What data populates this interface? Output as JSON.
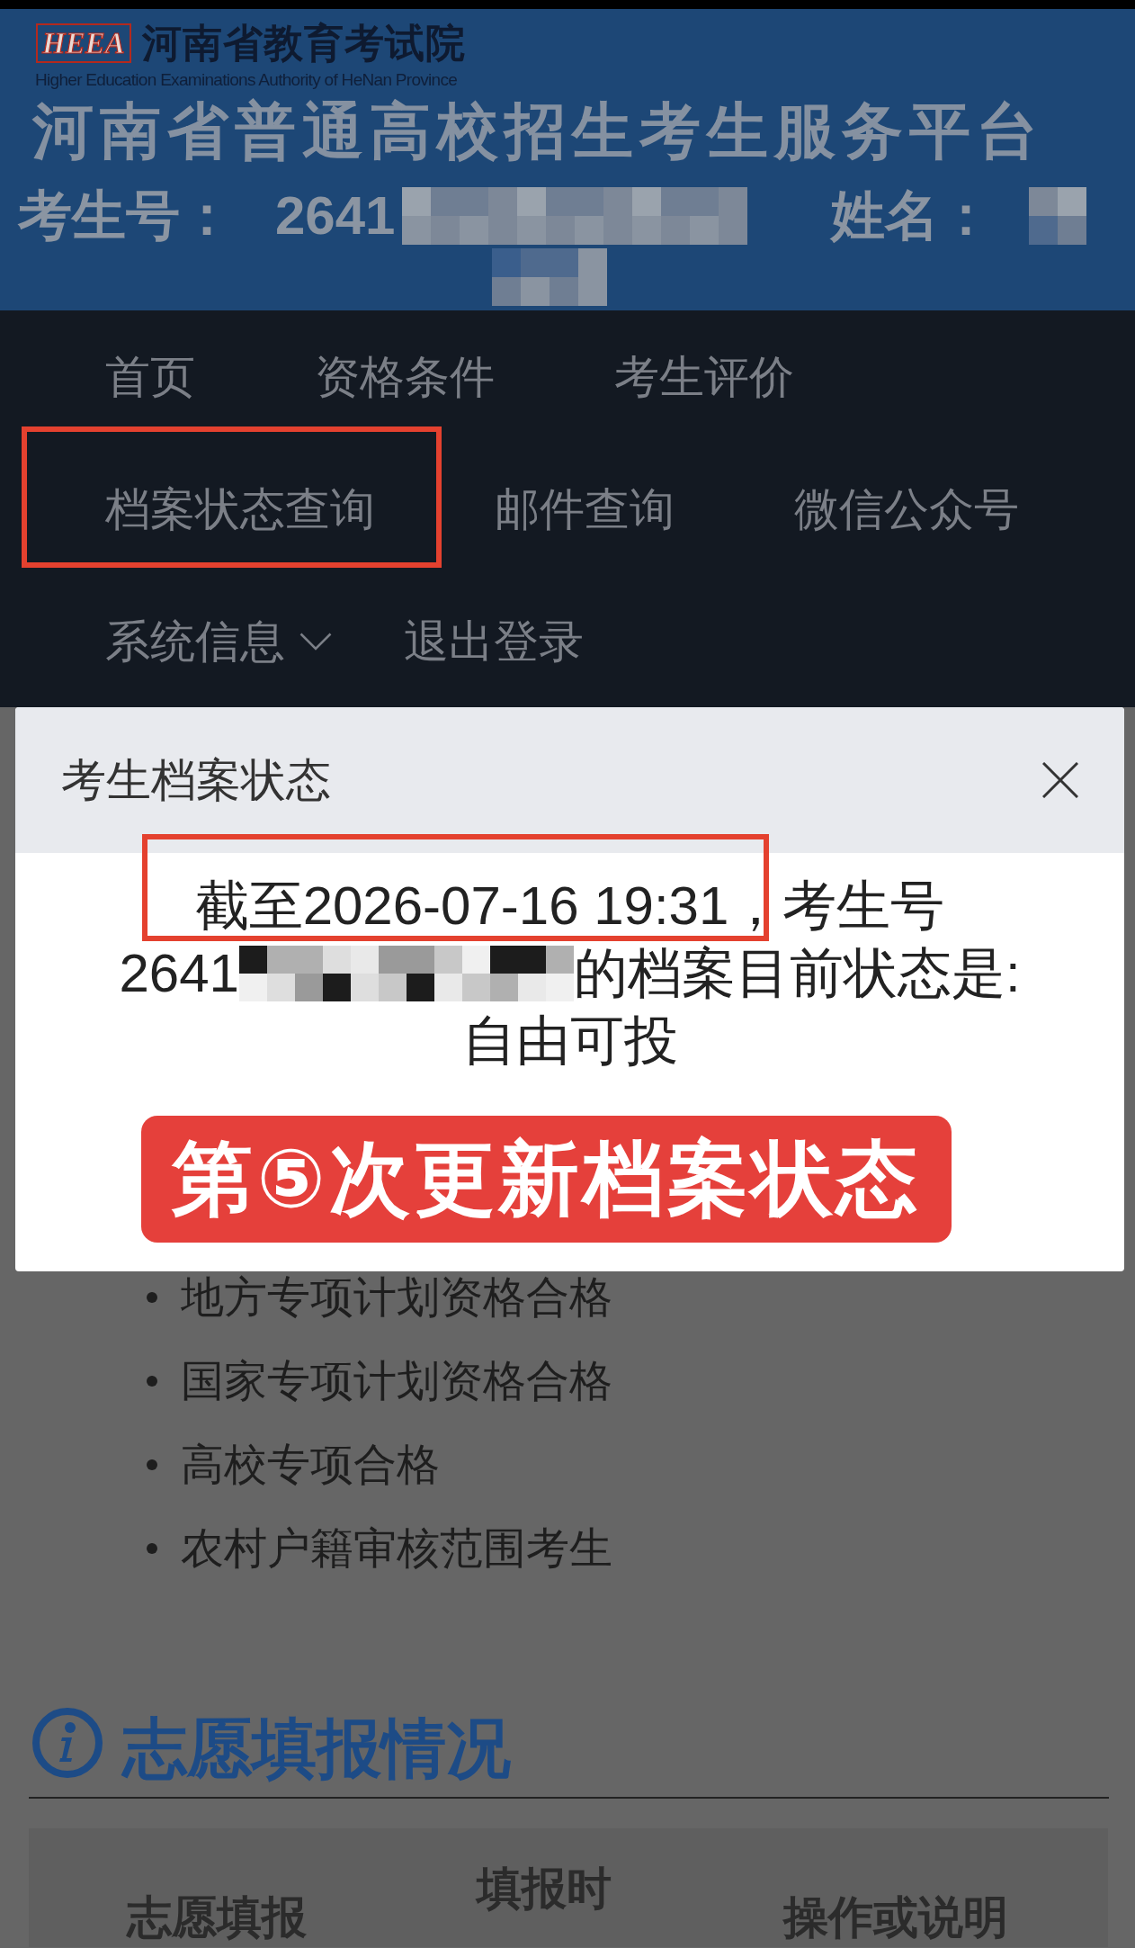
{
  "header": {
    "logo": {
      "mark": "HEEA",
      "name": "河南省教育考试院",
      "english": "Higher Education Examinations Authority of HeNan Province"
    },
    "title": "河南省普通高校招生考生服务平台",
    "candidate": {
      "exam_number_label": "考生号：",
      "exam_number": "2641",
      "exam_number_redacted": true,
      "name_label": "姓名：",
      "name_redacted": true
    }
  },
  "navigation": {
    "items": [
      {
        "label": "首页",
        "highlighted": false,
        "dropdown": false
      },
      {
        "label": "资格条件",
        "highlighted": false,
        "dropdown": false
      },
      {
        "label": "考生评价",
        "highlighted": false,
        "dropdown": false
      },
      {
        "label": "档案状态查询",
        "highlighted": true,
        "dropdown": false
      },
      {
        "label": "邮件查询",
        "highlighted": false,
        "dropdown": false
      },
      {
        "label": "微信公众号",
        "highlighted": false,
        "dropdown": false
      },
      {
        "label": "系统信息",
        "highlighted": false,
        "dropdown": true
      },
      {
        "label": "退出登录",
        "highlighted": false,
        "dropdown": false
      }
    ]
  },
  "dialog": {
    "title": "考生档案状态",
    "message": {
      "lines": [
        {
          "parts": [
            {
              "kind": "text",
              "text": "截至2026-07-16 19:31，",
              "highlighted": true
            },
            {
              "kind": "text",
              "text": "考生号",
              "highlighted": false
            }
          ]
        },
        {
          "parts": [
            {
              "kind": "text",
              "text": "2641",
              "highlighted": false
            },
            {
              "kind": "redacted"
            },
            {
              "kind": "text",
              "text": "的档案目前状态是:",
              "highlighted": false
            }
          ]
        },
        {
          "parts": [
            {
              "kind": "text",
              "text": "自由可投",
              "highlighted": false
            }
          ]
        }
      ]
    },
    "banner": {
      "text": "第⑤次更新档案状态"
    }
  },
  "qualifications": {
    "items": [
      "地方专项计划资格合格",
      "国家专项计划资格合格",
      "高校专项合格",
      "农村户籍审核范围考生"
    ]
  },
  "application_section": {
    "heading": "志愿填报情况",
    "table": {
      "columns": [
        "志愿填报",
        "填报时",
        "操作或说明"
      ]
    }
  }
}
